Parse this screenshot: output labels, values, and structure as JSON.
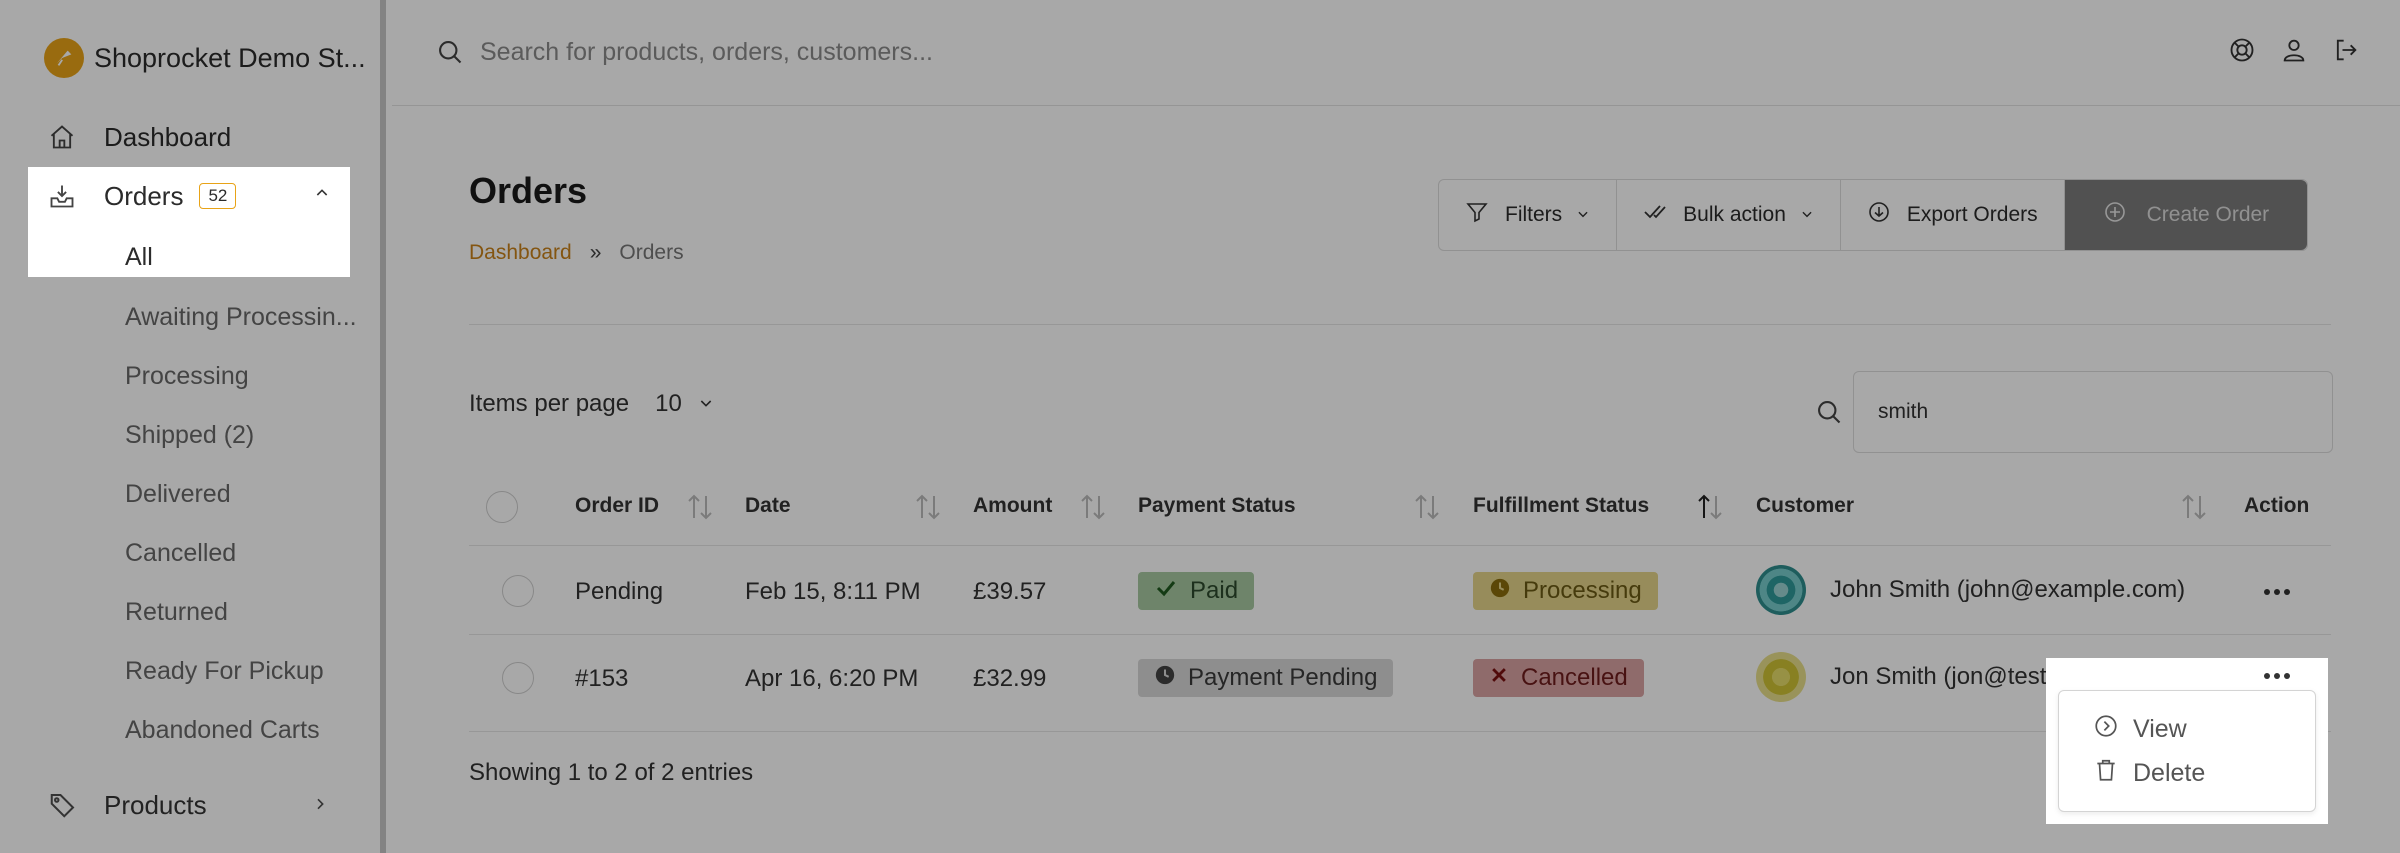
{
  "sidebar": {
    "brand": "Shoprocket Demo St...",
    "nav": {
      "dashboard": "Dashboard",
      "orders": "Orders",
      "orders_badge": "52",
      "products": "Products"
    },
    "orders_sub": [
      "All",
      "Awaiting Processin...",
      "Processing",
      "Shipped (2)",
      "Delivered",
      "Cancelled",
      "Returned",
      "Ready For Pickup",
      "Abandoned Carts"
    ]
  },
  "topbar": {
    "search_placeholder": "Search for products, orders, customers..."
  },
  "page": {
    "title": "Orders",
    "breadcrumb": {
      "home": "Dashboard",
      "sep": "»",
      "current": "Orders"
    }
  },
  "toolbar": {
    "filters": "Filters",
    "bulk_action": "Bulk action",
    "export": "Export Orders",
    "create": "Create Order"
  },
  "table_controls": {
    "items_per_page_label": "Items per page",
    "items_per_page_value": "10",
    "search_value": "smith"
  },
  "table": {
    "headers": {
      "order_id": "Order ID",
      "date": "Date",
      "amount": "Amount",
      "payment_status": "Payment Status",
      "fulfillment_status": "Fulfillment Status",
      "customer": "Customer",
      "action": "Action"
    },
    "rows": [
      {
        "order_id": "Pending",
        "date": "Feb 15, 8:11 PM",
        "amount": "£39.57",
        "payment_status": "Paid",
        "fulfillment_status": "Processing",
        "customer": "John Smith (john@example.com)"
      },
      {
        "order_id": "#153",
        "date": "Apr 16, 6:20 PM",
        "amount": "£32.99",
        "payment_status": "Payment Pending",
        "fulfillment_status": "Cancelled",
        "customer": "Jon Smith (jon@test.com)"
      }
    ],
    "footer": "Showing 1 to 2 of 2 entries"
  },
  "action_menu": {
    "view": "View",
    "delete": "Delete"
  },
  "colors": {
    "accent": "#e8a317",
    "link": "#c8821a",
    "paid": "#a8c9a2",
    "processing": "#e5d58a",
    "cancelled": "#d9a3a3",
    "pending": "#d8d8d8"
  }
}
